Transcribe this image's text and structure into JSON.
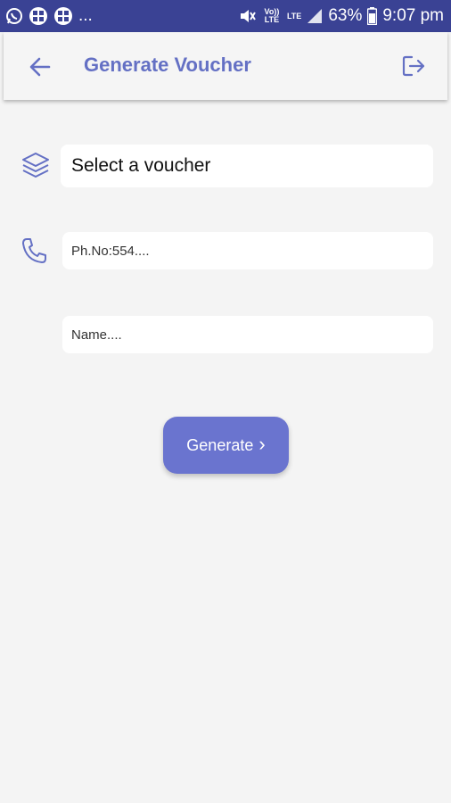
{
  "status_bar": {
    "more_indicator": "...",
    "battery_percent": "63%",
    "time": "9:07 pm",
    "volte_label": "Vo)) LTE",
    "lte_label": "LTE"
  },
  "app_bar": {
    "title": "Generate Voucher"
  },
  "form": {
    "voucher_select_label": "Select a voucher",
    "phone_placeholder": "Ph.No:554....",
    "name_placeholder": "Name....",
    "generate_label": "Generate",
    "generate_chevron": "›"
  },
  "colors": {
    "status_bar_bg": "#3a4294",
    "accent": "#6470c4",
    "button_bg": "#6a74cf",
    "page_bg": "#f4f4f4"
  },
  "icons": [
    "whatsapp-icon",
    "gallery-icon",
    "gallery-icon-2",
    "mute-icon",
    "signal-icon",
    "battery-icon",
    "back-arrow-icon",
    "logout-icon",
    "layers-icon",
    "phone-icon"
  ]
}
